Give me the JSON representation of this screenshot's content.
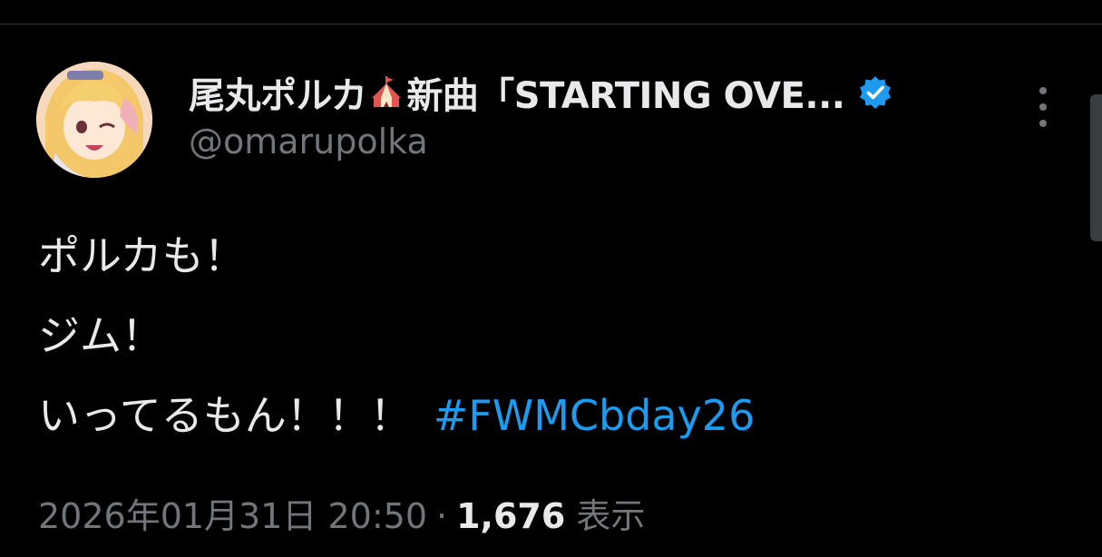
{
  "tweet": {
    "author": {
      "display_name_part1": "尾丸ポルカ",
      "display_name_icon": "circus-tent-icon",
      "display_name_part2": "新曲「STARTING OVE...",
      "handle": "@omarupolka",
      "verified": true,
      "verified_icon": "verified-badge-icon"
    },
    "more_icon": "more-vertical-icon",
    "body_lines": [
      "ポルカも！",
      "ジム！",
      "いってるもん！！！"
    ],
    "hashtag": "#FWMCbday26",
    "timestamp": "2026年01月31日 20:50",
    "separator": "·",
    "views_count": "1,676",
    "views_label": "表示"
  },
  "colors": {
    "background": "#000000",
    "text_primary": "#e7e9ea",
    "text_secondary": "#71767b",
    "link": "#1d9bf0",
    "verified": "#1d9bf0"
  }
}
